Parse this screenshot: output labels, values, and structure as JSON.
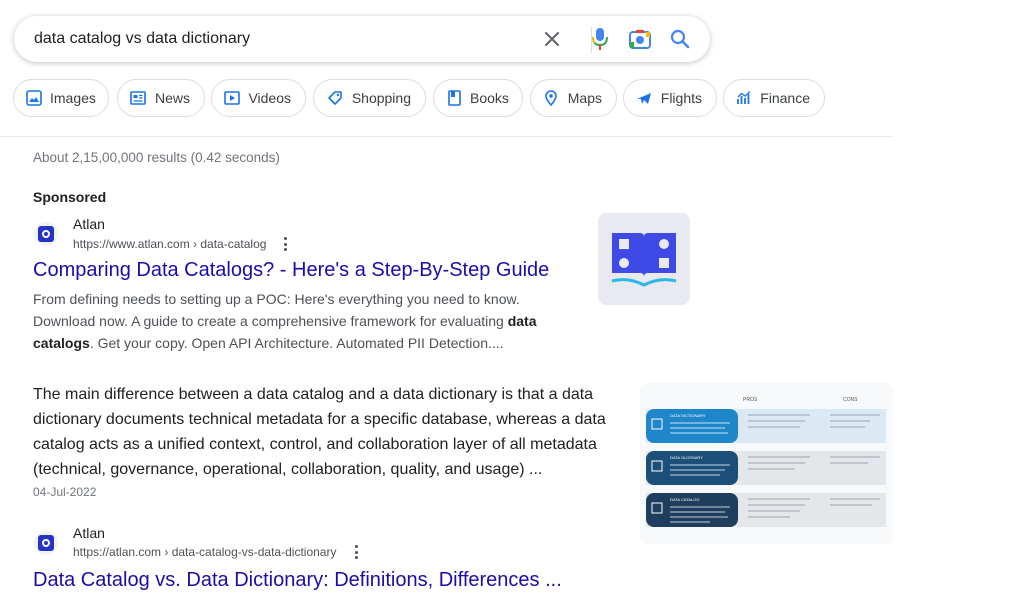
{
  "search": {
    "query": "data catalog vs data dictionary"
  },
  "chips": [
    {
      "label": "Images",
      "icon": "image-icon"
    },
    {
      "label": "News",
      "icon": "news-icon"
    },
    {
      "label": "Videos",
      "icon": "video-icon"
    },
    {
      "label": "Shopping",
      "icon": "tag-icon"
    },
    {
      "label": "Books",
      "icon": "book-icon"
    },
    {
      "label": "Maps",
      "icon": "map-pin-icon"
    },
    {
      "label": "Flights",
      "icon": "airplane-icon"
    },
    {
      "label": "Finance",
      "icon": "finance-icon"
    }
  ],
  "results_stats": "About 2,15,00,000 results (0.42 seconds)",
  "ad": {
    "sponsored_label": "Sponsored",
    "site_name": "Atlan",
    "url": "https://www.atlan.com › data-catalog",
    "title": "Comparing Data Catalogs? - Here's a Step-By-Step Guide",
    "desc_part1": "From defining needs to setting up a POC: Here's everything you need to know. Download now. A guide to create a comprehensive framework for evaluating ",
    "desc_bold": "data catalogs",
    "desc_part2": ". Get your copy. Open API Architecture. Automated PII Detection...."
  },
  "featured_snippet": {
    "text": "The main difference between a data catalog and a data dictionary is that a data dictionary documents technical metadata for a specific database, whereas a data catalog acts as a unified context, control, and collaboration layer of all metadata (technical, governance, operational, collaboration, quality, and usage) ...",
    "date": "04-Jul-2022"
  },
  "snippet_image": {
    "header_col1": "PROS",
    "header_col2": "CONS",
    "rows": [
      {
        "label": "DATA DICTIONARY"
      },
      {
        "label": "DATA GLOSSARY"
      },
      {
        "label": "DATA CATALOG"
      }
    ]
  },
  "result2": {
    "site_name": "Atlan",
    "url": "https://atlan.com › data-catalog-vs-data-dictionary",
    "title": "Data Catalog vs. Data Dictionary: Definitions, Differences ..."
  },
  "colors": {
    "link": "#1a0dab",
    "brand": "#2533c6",
    "mic_blue": "#4285f4",
    "mic_red": "#ea4335"
  }
}
